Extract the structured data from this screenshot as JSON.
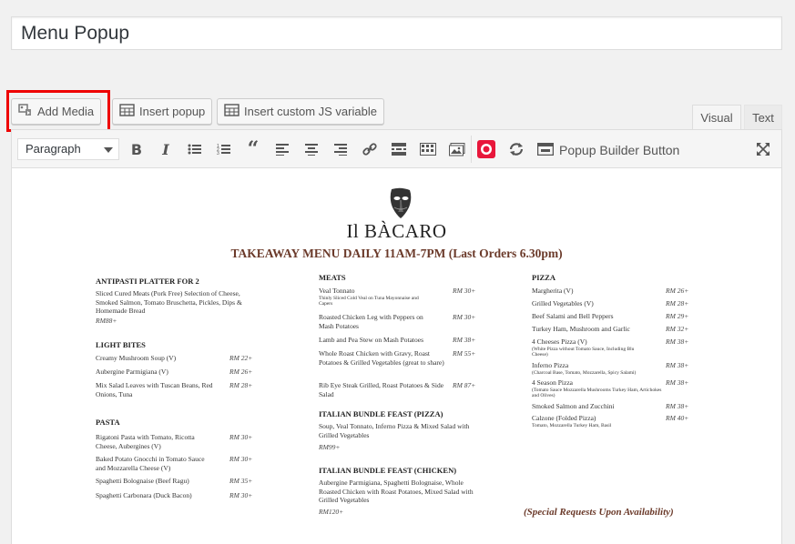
{
  "title": "Menu Popup",
  "buttons": {
    "add_media": "Add Media",
    "insert_popup": "Insert popup",
    "insert_js": "Insert custom JS variable"
  },
  "tabs": {
    "visual": "Visual",
    "text": "Text"
  },
  "toolbar": {
    "format": "Paragraph",
    "bold": "B",
    "italic": "I",
    "popup_builder": "Popup Builder Button"
  },
  "menu": {
    "brand": "Il BÀCARO",
    "subtitle": "TAKEAWAY MENU DAILY 11AM-7PM (Last Orders 6.30pm)",
    "special": "(Special Requests Upon Availability)",
    "col1": {
      "antipasti_title": "ANTIPASTI PLATTER FOR 2",
      "antipasti_desc": "Sliced Cured Meats (Pork Free) Selection of Cheese, Smoked Salmon, Tomato Bruschetta, Pickles, Dips & Homemade Bread",
      "antipasti_price": "RM88+",
      "light_title": "LIGHT BITES",
      "light": [
        {
          "name": "Creamy Mushroom Soup (V)",
          "price": "RM 22+"
        },
        {
          "name": "Aubergine Parmigiana (V)",
          "price": "RM 26+"
        },
        {
          "name": "Mix Salad Leaves with Tuscan Beans, Red Onions, Tuna",
          "price": "RM 28+"
        }
      ],
      "pasta_title": "PASTA",
      "pasta": [
        {
          "name": "Rigatoni Pasta with Tomato, Ricotta Cheese, Aubergines (V)",
          "price": "RM 30+"
        },
        {
          "name": "Baked Potato Gnocchi in Tomato Sauce and Mozzarella Cheese (V)",
          "price": "RM 30+"
        },
        {
          "name": "Spaghetti Bolognaise (Beef Ragu)",
          "price": "RM 35+"
        },
        {
          "name": "Spaghetti Carbonara (Duck Bacon)",
          "price": "RM 30+"
        }
      ]
    },
    "col2": {
      "meats_title": "MEATS",
      "meats": [
        {
          "name": "Veal Tonnato",
          "desc": "Thinly Sliced Cold Veal on Tuna Mayonnaise and Capers",
          "price": "RM 30+"
        },
        {
          "name": "Roasted Chicken Leg with Peppers on Mash Potatoes",
          "price": "RM 30+"
        },
        {
          "name": "Lamb and Pea Stew on Mash Potatoes",
          "price": "RM 38+"
        },
        {
          "name": "Whole Roast Chicken with Gravy, Roast Potatoes & Grilled Vegetables (great to share)",
          "price": "RM 55+"
        },
        {
          "name": "Rib Eye Steak Grilled, Roast Potatoes & Side Salad",
          "price": "RM 87+"
        }
      ],
      "bundle_pizza_title": "ITALIAN BUNDLE FEAST (PIZZA)",
      "bundle_pizza_desc": "Soup, Veal Tonnato, Inferno Pizza & Mixed Salad with Grilled Vegetables",
      "bundle_pizza_price": "RM99+",
      "bundle_chicken_title": "ITALIAN BUNDLE FEAST (CHICKEN)",
      "bundle_chicken_desc": "Aubergine Parmigiana, Spaghetti Bolognaise, Whole Roasted Chicken with Roast Potatoes, Mixed Salad with Grilled Vegetables",
      "bundle_chicken_price": "RM120+"
    },
    "col3": {
      "pizza_title": "PIZZA",
      "pizza": [
        {
          "name": "Margherita (V)",
          "price": "RM 26+"
        },
        {
          "name": "Grilled Vegetables (V)",
          "price": "RM 28+"
        },
        {
          "name": "Beef Salami and Bell Peppers",
          "price": "RM 29+"
        },
        {
          "name": "Turkey Ham, Mushroom and Garlic",
          "price": "RM 32+"
        },
        {
          "name": "4 Cheeses Pizza (V)",
          "desc": "(White Pizza without Tomato Sauce, Including Blu Cheese)",
          "price": "RM 38+"
        },
        {
          "name": "Inferno Pizza",
          "desc": "(Charcoal Base, Tomato, Mozzarella, Spicy Salami)",
          "price": "RM 38+"
        },
        {
          "name": "4 Season Pizza",
          "desc": "(Tomato Sauce Mozzarella Mushrooms Turkey Ham, Artichokes and Olives)",
          "price": "RM 38+"
        },
        {
          "name": "Smoked Salmon and Zucchini",
          "price": "RM 38+"
        },
        {
          "name": "Calzone (Folded Pizza)",
          "desc": "Tomato, Mozzarella Turkey Ham, Basil",
          "price": "RM 40+"
        }
      ]
    }
  }
}
